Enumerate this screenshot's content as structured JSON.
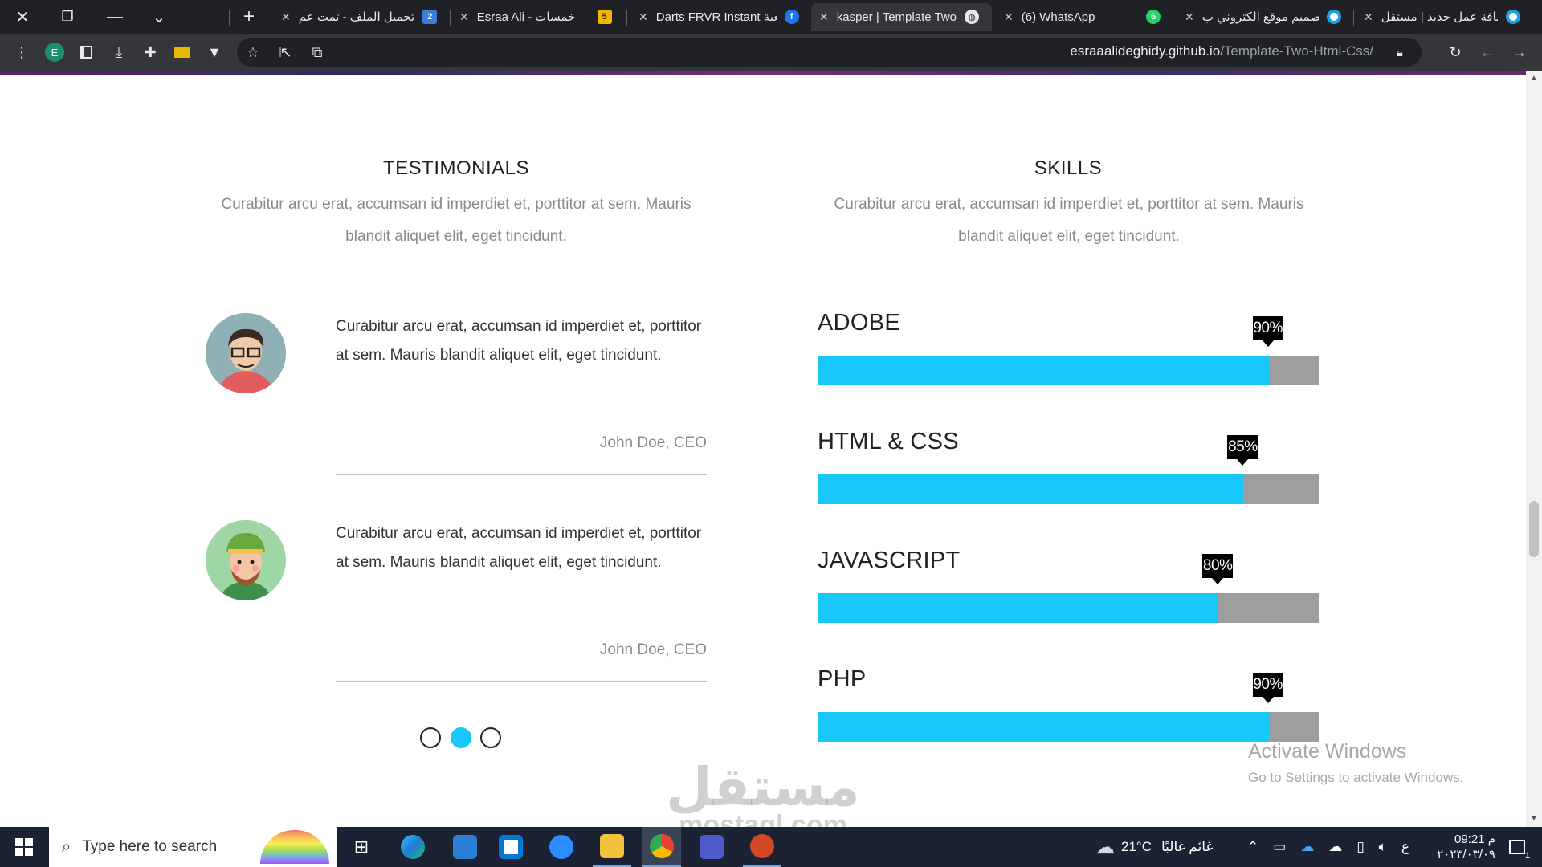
{
  "browser": {
    "window_controls": {
      "close_glyph": "✕",
      "restore_glyph": "❐",
      "minimize_glyph": "—",
      "menu_glyph": "⌄",
      "new_tab_glyph": "+"
    },
    "tabs": [
      {
        "title": "تحميل الملف - تمت عم",
        "favicon": "2"
      },
      {
        "title": "Esraa Ali - خمسات",
        "favicon": "5"
      },
      {
        "title": "Darts FRVR Instant لعبة",
        "favicon": "f"
      },
      {
        "title": "kasper | Template Two",
        "favicon": "globe",
        "active": true
      },
      {
        "title": "(6) WhatsApp",
        "favicon": "6"
      },
      {
        "title": "تصميم موقع الكتروني ب",
        "favicon": "o"
      },
      {
        "title": "إضافة عمل جديد | مستقل",
        "favicon": "o"
      }
    ],
    "url_host": "esraaalideghidy.github.io",
    "url_path": "/Template-Two-Html-Css/",
    "profile_initial": "E"
  },
  "testimonials": {
    "title": "TESTIMONIALS",
    "description": "Curabitur arcu erat, accumsan id imperdiet et, porttitor at sem. Mauris blandit aliquet elit, eget tincidunt.",
    "items": [
      {
        "quote": "Curabitur arcu erat, accumsan id imperdiet et, porttitor at sem. Mauris blandit aliquet elit, eget tincidunt.",
        "author": "John Doe, CEO"
      },
      {
        "quote": "Curabitur arcu erat, accumsan id imperdiet et, porttitor at sem. Mauris blandit aliquet elit, eget tincidunt.",
        "author": "John Doe, CEO"
      }
    ],
    "bullets": [
      {
        "active": false
      },
      {
        "active": true
      },
      {
        "active": false
      }
    ]
  },
  "skills": {
    "title": "SKILLS",
    "description": "Curabitur arcu erat, accumsan id imperdiet et, porttitor at sem. Mauris blandit aliquet elit, eget tincidunt.",
    "items": [
      {
        "name": "ADOBE",
        "percent_label": "90%",
        "value": 0.9
      },
      {
        "name": "HTML & CSS",
        "percent_label": "85%",
        "value": 0.85
      },
      {
        "name": "JAVASCRIPT",
        "percent_label": "80%",
        "value": 0.8
      },
      {
        "name": "PHP",
        "percent_label": "90%",
        "value": 0.9
      }
    ],
    "fill_color": "#19c8fa",
    "track_color": "#9e9e9e"
  },
  "windows_activation": {
    "title": "Activate Windows",
    "subtitle": "Go to Settings to activate Windows."
  },
  "watermark": {
    "arabic": "مستقل",
    "latin": "mostaql.com"
  },
  "taskbar": {
    "search_placeholder": "Type here to search",
    "weather_temp": "21°C",
    "weather_text": "غائم غالبًا",
    "language": "ع",
    "time": "09:21 م",
    "date": "٢٠٢٣/٠٣/٠٩",
    "notification_count": "1"
  },
  "colors": {
    "accent": "#19c8fa",
    "chrome_dark": "#202124",
    "chrome_toolbar": "#35363a",
    "taskbar": "#1a2233"
  }
}
